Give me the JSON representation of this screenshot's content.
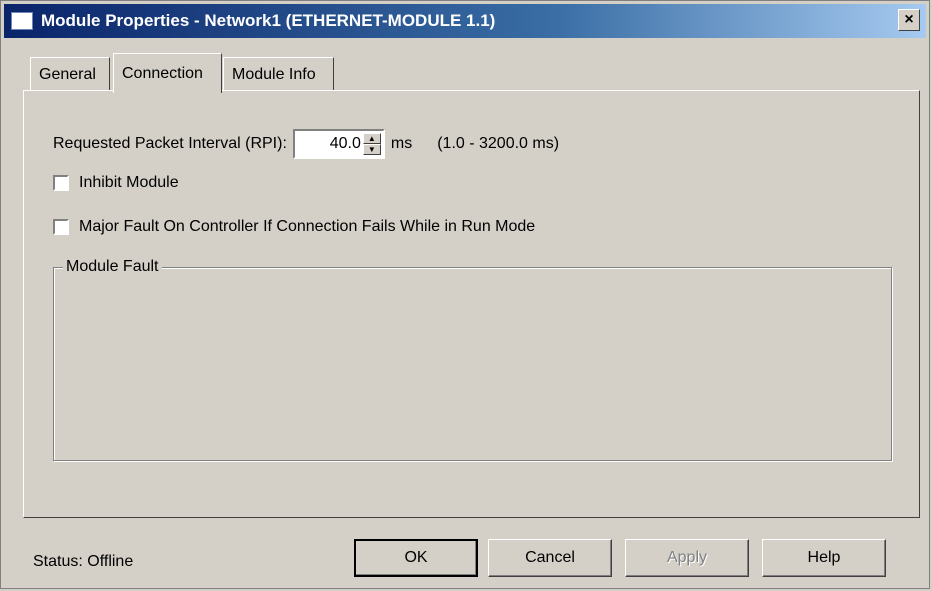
{
  "window": {
    "title": "Module Properties  - Network1 (ETHERNET-MODULE 1.1)",
    "close_label": "×"
  },
  "tabs": [
    {
      "label": "General",
      "active": false
    },
    {
      "label": "Connection",
      "active": true
    },
    {
      "label": "Module Info",
      "active": false
    }
  ],
  "connection": {
    "rpi_label": "Requested Packet Interval (RPI):",
    "rpi_value": "40.0",
    "rpi_unit": "ms",
    "rpi_range": "(1.0 - 3200.0 ms)",
    "inhibit_label": "Inhibit Module",
    "inhibit_checked": false,
    "major_fault_label": "Major Fault On Controller If Connection Fails While in Run Mode",
    "major_fault_checked": false,
    "module_fault_label": "Module Fault",
    "module_fault_text": ""
  },
  "footer": {
    "status_label": "Status:",
    "status_value": "Offline",
    "ok": "OK",
    "cancel": "Cancel",
    "apply": "Apply",
    "help": "Help"
  },
  "colors": {
    "dialog_bg": "#d4d0c8",
    "titlebar_start": "#0a246a",
    "titlebar_end": "#a6caf0"
  }
}
